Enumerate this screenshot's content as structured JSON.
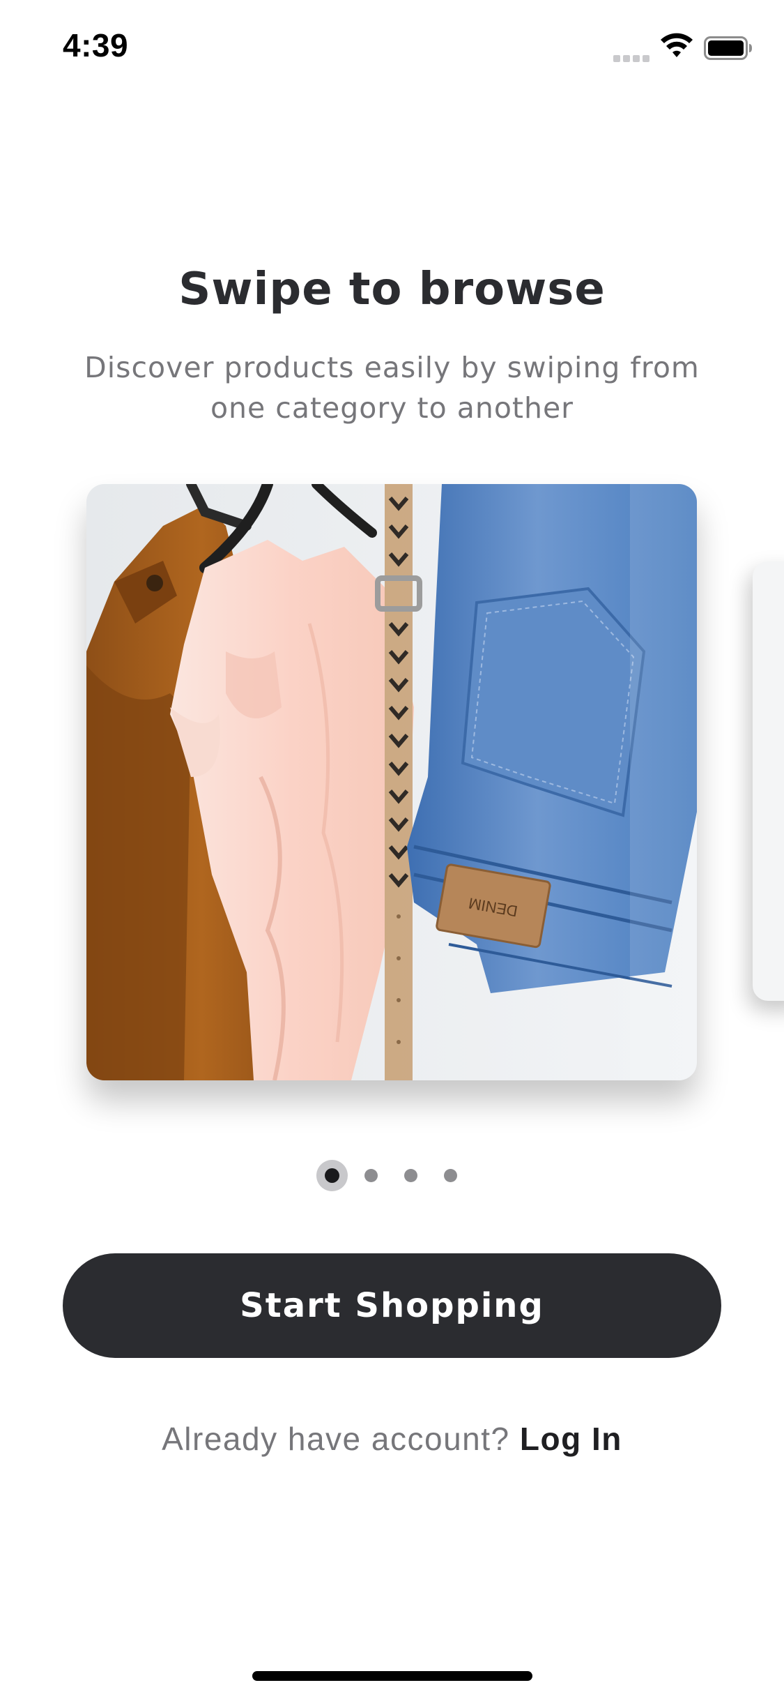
{
  "status_bar": {
    "time": "4:39",
    "icons": [
      "cellular-signal-icon",
      "wifi-icon",
      "battery-icon"
    ]
  },
  "onboarding": {
    "title": "Swipe to browse",
    "subtitle": "Discover products easily by swiping from one category to another",
    "carousel": {
      "current_page": 1,
      "total_pages": 4,
      "image_subject": "clothes on hangers: brown jacket, pink blouse, belt, denim jeans",
      "patch_label": "DENIM"
    },
    "cta_label": "Start Shopping",
    "login_prompt": "Already have account?",
    "login_link": "Log In"
  },
  "colors": {
    "primary_dark": "#2b2c30",
    "secondary_text": "#76767a",
    "dot_inactive": "#8d8d90",
    "background": "#ffffff"
  }
}
